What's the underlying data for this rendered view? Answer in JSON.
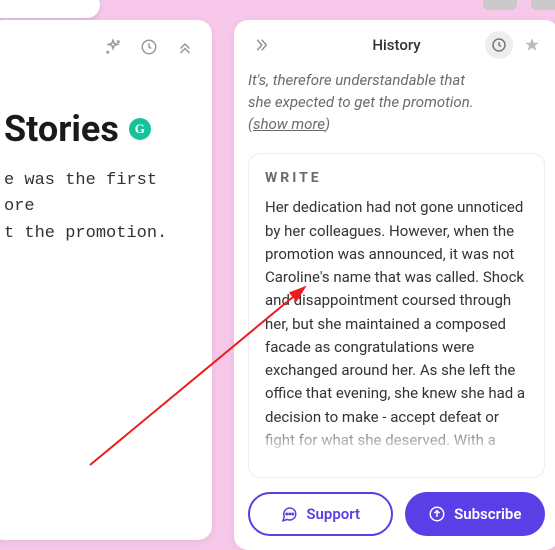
{
  "left": {
    "title": "Stories",
    "body": "e was the first\nore\nt the promotion."
  },
  "right": {
    "header_title": "History",
    "intro_line1": "It's, therefore understandable that",
    "intro_line2": "she expected to get the promotion.",
    "show_more_open": "(",
    "show_more": "show more",
    "show_more_close": ")",
    "write_label": "WRITE",
    "write_body": "Her dedication had not gone unnoticed by her colleagues. However, when the promotion was announced, it was not Caroline's name that was called. Shock and disappointment coursed through her, but she maintained a composed facade as congratulations were exchanged around her. As she left the office that evening, she knew she had a decision to make - accept defeat or fight for what she deserved. With a steely glint in her eye, Caroline made"
  },
  "buttons": {
    "support": "Support",
    "subscribe": "Subscribe"
  }
}
